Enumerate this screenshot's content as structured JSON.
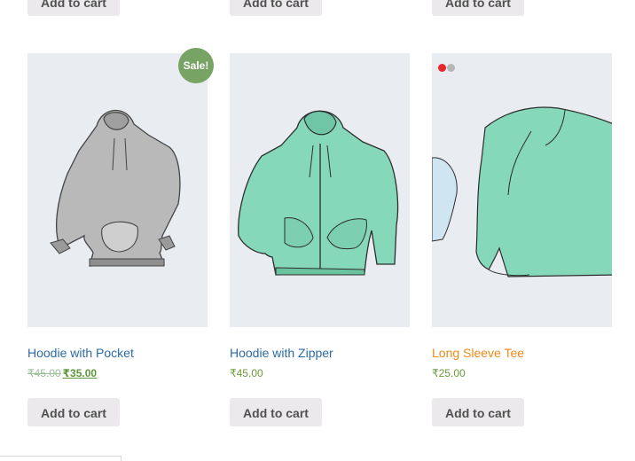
{
  "top_row": {
    "buttons": [
      "Add to cart",
      "Add to cart",
      "Add to cart"
    ]
  },
  "products": [
    {
      "title": "Hoodie with Pocket",
      "old_price": "₹45.00",
      "price": "₹35.00",
      "badge": "Sale!",
      "button": "Add to cart",
      "icon": "gray-hoodie-with-pocket"
    },
    {
      "title": "Hoodie with Zipper",
      "price": "₹45.00",
      "button": "Add to cart",
      "icon": "mint-zip-hoodie"
    },
    {
      "title": "Long Sleeve Tee",
      "price": "₹25.00",
      "button": "Add to cart",
      "icon": "mint-long-sleeve-tee",
      "gallery_dots": [
        "#e8262b",
        "#b7b7b7"
      ]
    }
  ],
  "colors": {
    "link": "#2c6ba6",
    "hover_link": "#ee8a17",
    "sale_badge": "#77a464",
    "price": "#5f963c",
    "button_bg": "#ebe9eb",
    "image_bg": "#e9edf1"
  }
}
